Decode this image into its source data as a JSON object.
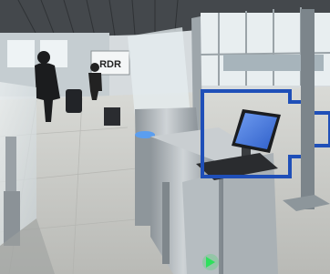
{
  "scene": {
    "sign_text": "RDR",
    "colors": {
      "ceiling": "#3f4347",
      "floor": "#c7c8c4",
      "glass": "#dfe5e7",
      "steel": "#a9afb3",
      "highlight_box": "#1f4fb8",
      "tablet_screen": "#4d7fe0",
      "indicator_light": "#2ee05c"
    },
    "icons": [
      "highlight-arrow-icon",
      "indicator-arrow-icon"
    ]
  }
}
